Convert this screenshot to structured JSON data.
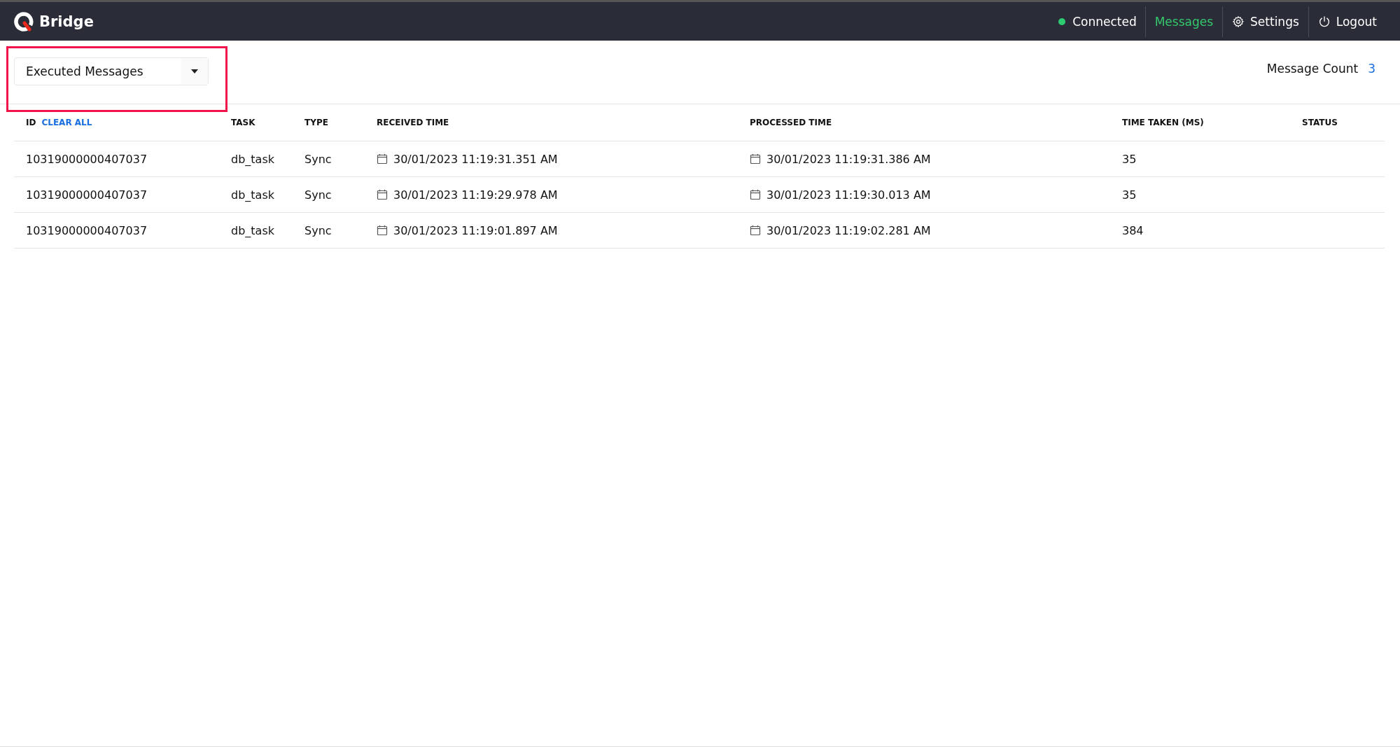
{
  "header": {
    "brand": "Bridge",
    "status": {
      "label": "Connected",
      "color": "#2ecc71"
    },
    "nav": [
      {
        "label": "Messages",
        "kind": "link",
        "selected": true
      },
      {
        "label": "Settings",
        "kind": "settings",
        "selected": false
      },
      {
        "label": "Logout",
        "kind": "logout",
        "selected": false
      }
    ]
  },
  "filter": {
    "value": "Executed Messages"
  },
  "message_count": {
    "label": "Message Count",
    "value": "3"
  },
  "table": {
    "clear_all": "CLEAR ALL",
    "columns": [
      "ID",
      "TASK",
      "TYPE",
      "RECEIVED TIME",
      "PROCESSED TIME",
      "TIME TAKEN (MS)",
      "STATUS"
    ],
    "rows": [
      {
        "id": "10319000000407037",
        "task": "db_task",
        "type": "Sync",
        "received": "30/01/2023 11:19:31.351 AM",
        "processed": "30/01/2023 11:19:31.386 AM",
        "time_taken": "35"
      },
      {
        "id": "10319000000407037",
        "task": "db_task",
        "type": "Sync",
        "received": "30/01/2023 11:19:29.978 AM",
        "processed": "30/01/2023 11:19:30.013 AM",
        "time_taken": "35"
      },
      {
        "id": "10319000000407037",
        "task": "db_task",
        "type": "Sync",
        "received": "30/01/2023 11:19:01.897 AM",
        "processed": "30/01/2023 11:19:02.281 AM",
        "time_taken": "384"
      }
    ]
  }
}
